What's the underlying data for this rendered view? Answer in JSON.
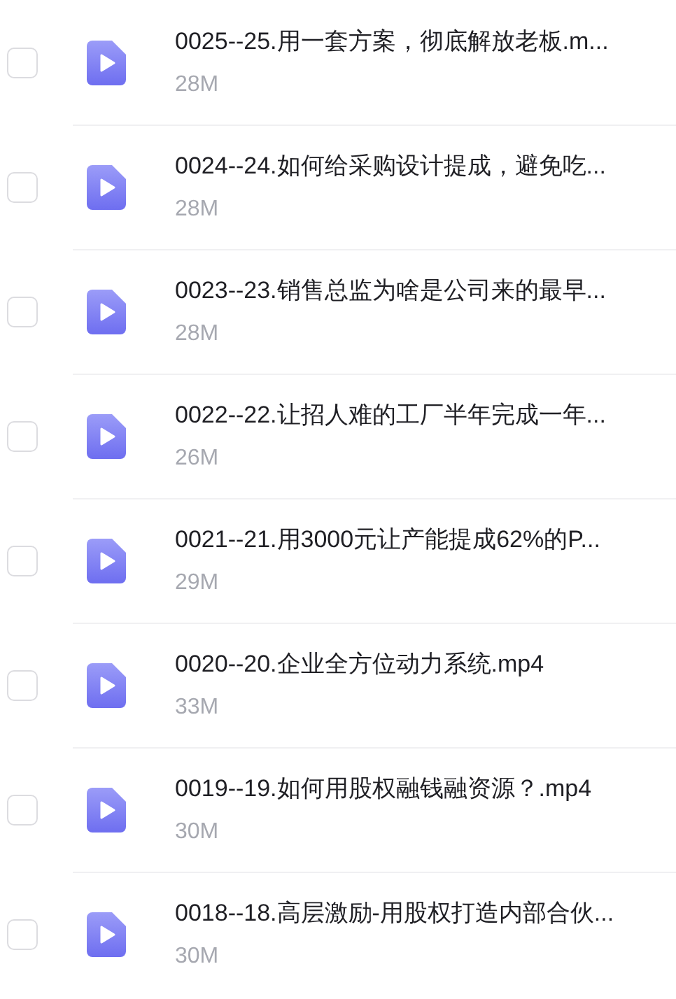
{
  "files": [
    {
      "name": "0025--25.用一套方案，彻底解放老板.m...",
      "size": "28M",
      "checked": false
    },
    {
      "name": "0024--24.如何给采购设计提成，避免吃...",
      "size": "28M",
      "checked": false
    },
    {
      "name": "0023--23.销售总监为啥是公司来的最早...",
      "size": "28M",
      "checked": false
    },
    {
      "name": "0022--22.让招人难的工厂半年完成一年...",
      "size": "26M",
      "checked": false
    },
    {
      "name": "0021--21.用3000元让产能提成62%的P...",
      "size": "29M",
      "checked": false
    },
    {
      "name": "0020--20.企业全方位动力系统.mp4",
      "size": "33M",
      "checked": false
    },
    {
      "name": "0019--19.如何用股权融钱融资源？.mp4",
      "size": "30M",
      "checked": false
    },
    {
      "name": "0018--18.高层激励-用股权打造内部合伙...",
      "size": "30M",
      "checked": false
    }
  ]
}
